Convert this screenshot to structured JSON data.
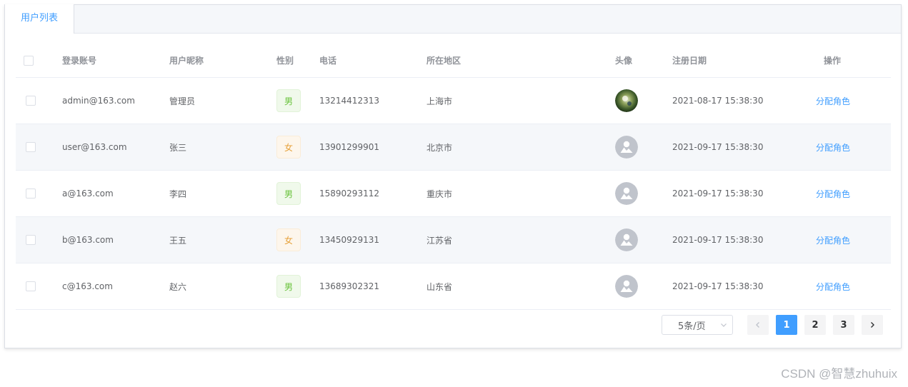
{
  "tabs": [
    {
      "label": "用户列表"
    }
  ],
  "table": {
    "headers": {
      "account": "登录账号",
      "nickname": "用户昵称",
      "gender": "性别",
      "phone": "电话",
      "region": "所在地区",
      "avatar": "头像",
      "date": "注册日期",
      "action": "操作"
    },
    "rows": [
      {
        "account": "admin@163.com",
        "nickname": "管理员",
        "gender": "男",
        "phone": "13214412313",
        "region": "上海市",
        "avatar": "photo-avatar",
        "date": "2021-08-17 15:38:30",
        "action": "分配角色"
      },
      {
        "account": "user@163.com",
        "nickname": "张三",
        "gender": "女",
        "phone": "13901299901",
        "region": "北京市",
        "avatar": "default-avatar-icon",
        "date": "2021-09-17 15:38:30",
        "action": "分配角色"
      },
      {
        "account": "a@163.com",
        "nickname": "李四",
        "gender": "男",
        "phone": "15890293112",
        "region": "重庆市",
        "avatar": "default-avatar-icon",
        "date": "2021-09-17 15:38:30",
        "action": "分配角色"
      },
      {
        "account": "b@163.com",
        "nickname": "王五",
        "gender": "女",
        "phone": "13450929131",
        "region": "江苏省",
        "avatar": "default-avatar-icon",
        "date": "2021-09-17 15:38:30",
        "action": "分配角色"
      },
      {
        "account": "c@163.com",
        "nickname": "赵六",
        "gender": "男",
        "phone": "13689302321",
        "region": "山东省",
        "avatar": "default-avatar-icon",
        "date": "2021-09-17 15:38:30",
        "action": "分配角色"
      }
    ]
  },
  "pagination": {
    "page_size_label": "5条/页",
    "pages": [
      "1",
      "2",
      "3"
    ],
    "current": "1",
    "prev_icon": "chevron-left-icon",
    "next_icon": "chevron-right-icon"
  },
  "watermark": "CSDN @智慧zhuhuix",
  "colors": {
    "accent": "#409eff",
    "male_tag": "#67c23a",
    "female_tag": "#e6a23c",
    "row_stripe": "#f5f7fa"
  }
}
